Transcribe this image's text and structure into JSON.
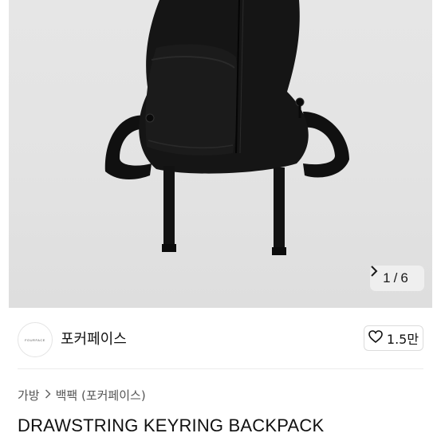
{
  "gallery": {
    "counter_current": "1",
    "counter_separator": "/",
    "counter_total": "6"
  },
  "seller": {
    "avatar_text": "FOURFACE",
    "name": "포커페이스"
  },
  "like": {
    "count": "1.5만"
  },
  "breadcrumb": {
    "level1": "가방",
    "level2": "백팩 (포커페이스)"
  },
  "product": {
    "title": "DRAWSTRING KEYRING BACKPACK"
  },
  "colors": {
    "photo_bg": "#e4e4e4",
    "bag": "#141414"
  }
}
